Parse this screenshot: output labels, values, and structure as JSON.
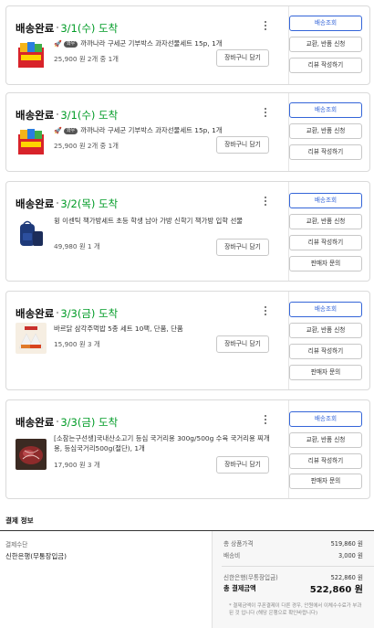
{
  "orders": [
    {
      "status": "배송완료",
      "date": "3/1(수) 도착",
      "rocket": "🚀",
      "badge": "와우",
      "product": "까까나라 구세군 기부박스 과자선물세트 15p, 1개",
      "price": "25,900 원  2개 중 1개",
      "cart_label": "장바구니 담기",
      "actions": [
        "배송조회",
        "교환, 반품 신청",
        "리뷰 작성하기"
      ],
      "thumb": "snack-box"
    },
    {
      "status": "배송완료",
      "date": "3/1(수) 도착",
      "rocket": "🚀",
      "badge": "와우",
      "product": "까까나라 구세군 기부박스 과자선물세트 15p, 1개",
      "price": "25,900 원  2개 중 1개",
      "cart_label": "장바구니 담기",
      "actions": [
        "배송조회",
        "교환, 반품 신청",
        "리뷰 작성하기"
      ],
      "thumb": "snack-box"
    },
    {
      "status": "배송완료",
      "date": "3/2(목) 도착",
      "product": "윙 이센틱 책가방세트 초등 학생 남아 가방 신학기 책가방 입학 선물",
      "price": "49,980 원  1 개",
      "cart_label": "장바구니 담기",
      "actions": [
        "배송조회",
        "교환, 반품 신청",
        "리뷰 작성하기",
        "판매자 문의"
      ],
      "thumb": "backpack"
    },
    {
      "status": "배송완료",
      "date": "3/3(금) 도착",
      "product": "바르닭 삼각주먹밥 5종 세트 10팩, 단품, 단품",
      "price": "15,900 원  3 개",
      "cart_label": "장바구니 담기",
      "actions": [
        "배송조회",
        "교환, 반품 신청",
        "리뷰 작성하기",
        "판매자 문의"
      ],
      "thumb": "rice-ball"
    },
    {
      "status": "배송완료",
      "date": "3/3(금) 도착",
      "product": "[소참는구선생]국내산소고기 등심 국거리용 300g/500g 수육 국거리용 찌개용, 등심국거리500g(절단), 1개",
      "price": "17,900 원  3 개",
      "cart_label": "장바구니 담기",
      "actions": [
        "배송조회",
        "교환, 반품 신청",
        "리뷰 작성하기",
        "판매자 문의"
      ],
      "thumb": "beef"
    }
  ],
  "payment": {
    "title": "결제 정보",
    "method_label": "결제수단",
    "method_value": "신한은행(무통장입금)",
    "product_total_label": "총 상품가격",
    "product_total_value": "519,860 원",
    "shipping_label": "배송비",
    "shipping_value": "3,000 원",
    "bank_label": "신한은행(무통장입금)",
    "bank_value": "522,860 원",
    "total_label": "총 결제금액",
    "total_value": "522,860 원",
    "note": "* 결제금액이 쿠폰결제이 다른 경우, 안원에서 이체수수료가 부과된 것 입니다 (해당 은행으로 확인바랍니다)"
  }
}
